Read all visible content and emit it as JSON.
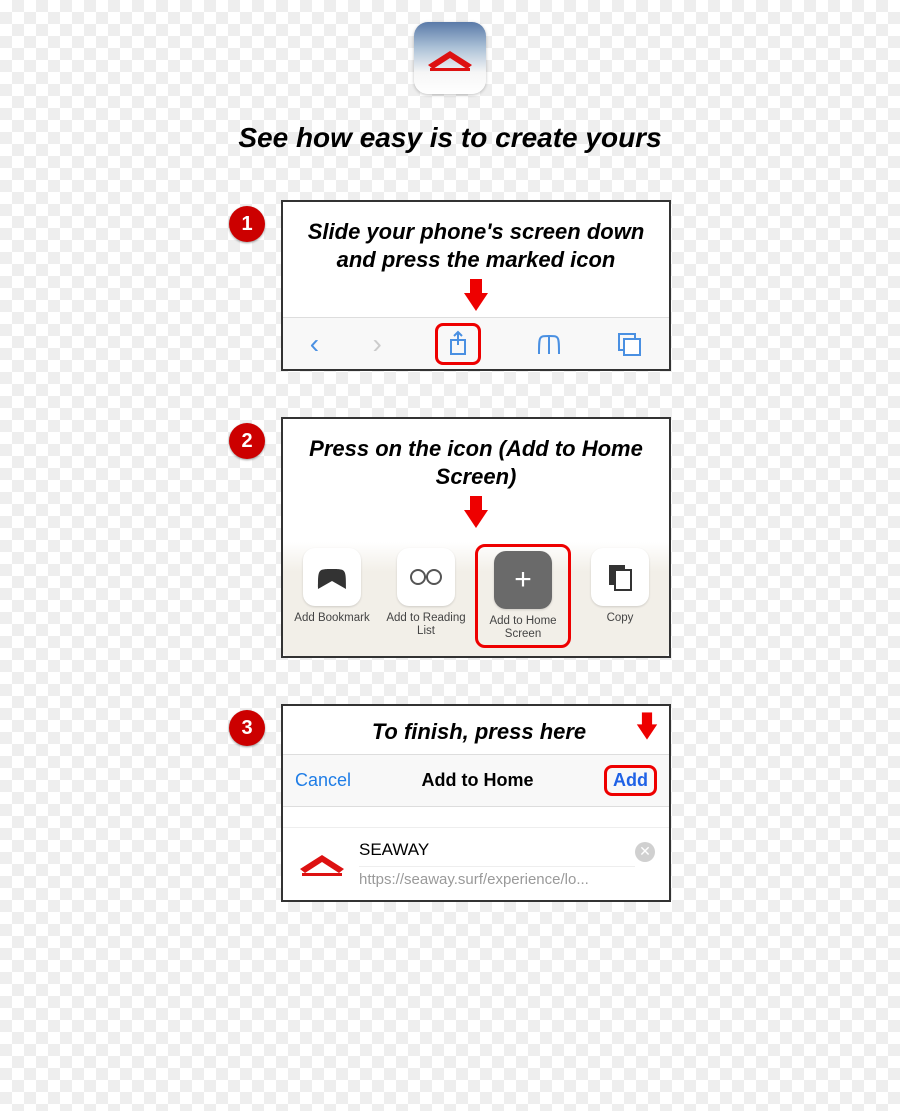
{
  "heading": "See how easy is to create yours",
  "steps": [
    {
      "number": "1",
      "instruction": "Slide your phone's screen down and press the marked icon"
    },
    {
      "number": "2",
      "instruction": "Press on the icon (Add to Home Screen)",
      "options": [
        {
          "label": "Add Bookmark"
        },
        {
          "label": "Add to Reading List"
        },
        {
          "label": "Add to Home Screen"
        },
        {
          "label": "Copy"
        }
      ]
    },
    {
      "number": "3",
      "instruction": "To finish, press here",
      "navbar": {
        "cancel": "Cancel",
        "title": "Add to Home",
        "add": "Add"
      },
      "detail": {
        "name": "SEAWAY",
        "url": "https://seaway.surf/experience/lo..."
      }
    }
  ]
}
